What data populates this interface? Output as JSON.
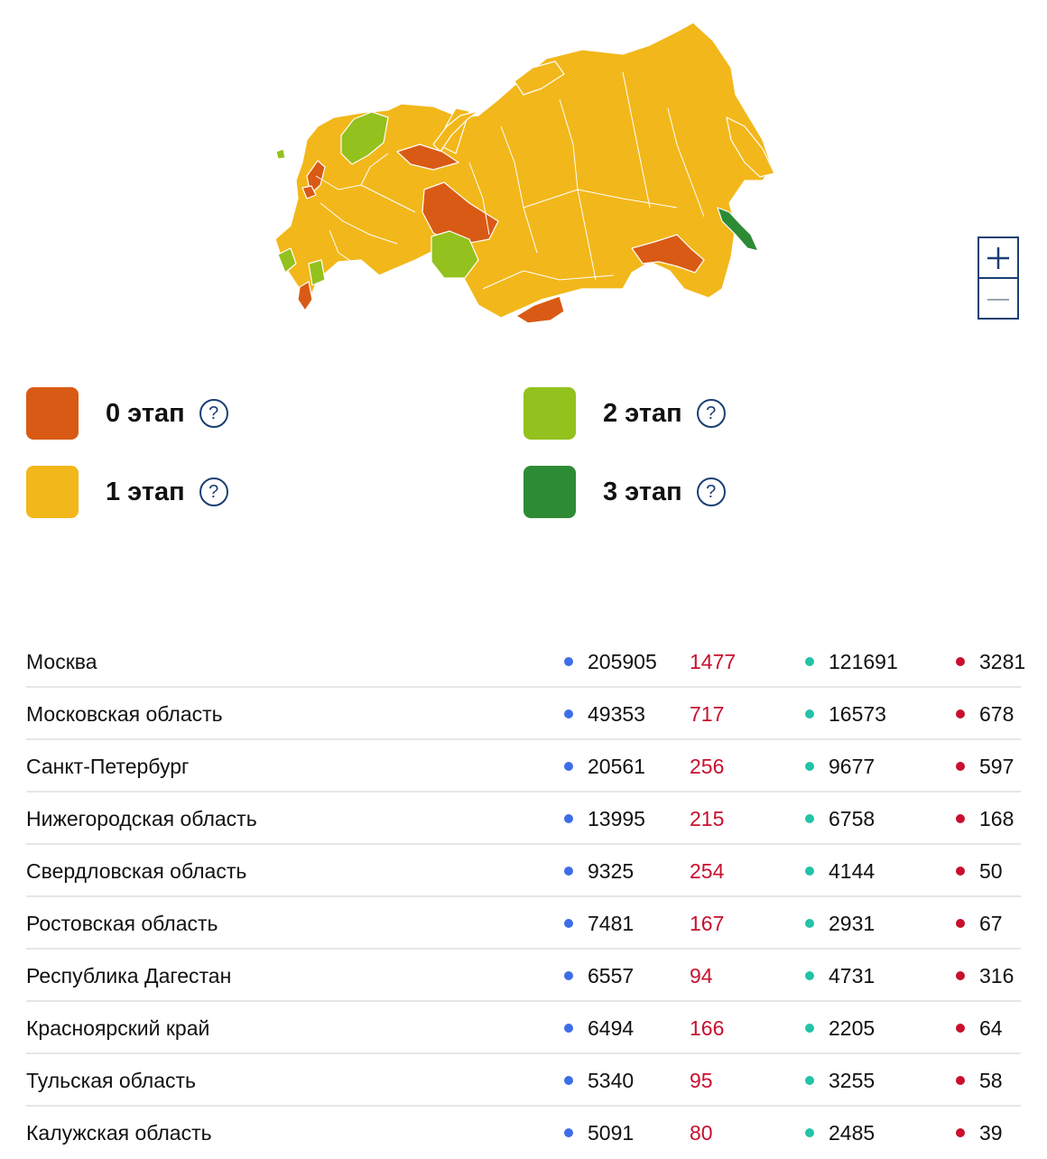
{
  "colors": {
    "stage0": "#d95a14",
    "stage1": "#f2b71a",
    "stage2": "#93c11d",
    "stage3": "#2e8b35",
    "accent": "#1b3f73",
    "new_cases": "#c8102e",
    "dot_cases": "#3d6ee8",
    "dot_recovered": "#22c3a6",
    "dot_deaths": "#c8102e"
  },
  "map": {
    "zoom_in_icon": "plus-icon",
    "zoom_out_icon": "minus-icon"
  },
  "legend": [
    {
      "label": "0 этап",
      "help": "?"
    },
    {
      "label": "1 этап",
      "help": "?"
    },
    {
      "label": "2 этап",
      "help": "?"
    },
    {
      "label": "3 этап",
      "help": "?"
    }
  ],
  "table": {
    "rows": [
      {
        "region": "Москва",
        "cases": "205905",
        "new": "1477",
        "recovered": "121691",
        "deaths": "3281"
      },
      {
        "region": "Московская область",
        "cases": "49353",
        "new": "717",
        "recovered": "16573",
        "deaths": "678"
      },
      {
        "region": "Санкт-Петербург",
        "cases": "20561",
        "new": "256",
        "recovered": "9677",
        "deaths": "597"
      },
      {
        "region": "Нижегородская область",
        "cases": "13995",
        "new": "215",
        "recovered": "6758",
        "deaths": "168"
      },
      {
        "region": "Свердловская область",
        "cases": "9325",
        "new": "254",
        "recovered": "4144",
        "deaths": "50"
      },
      {
        "region": "Ростовская область",
        "cases": "7481",
        "new": "167",
        "recovered": "2931",
        "deaths": "67"
      },
      {
        "region": "Республика Дагестан",
        "cases": "6557",
        "new": "94",
        "recovered": "4731",
        "deaths": "316"
      },
      {
        "region": "Красноярский край",
        "cases": "6494",
        "new": "166",
        "recovered": "2205",
        "deaths": "64"
      },
      {
        "region": "Тульская область",
        "cases": "5340",
        "new": "95",
        "recovered": "3255",
        "deaths": "58"
      },
      {
        "region": "Калужская область",
        "cases": "5091",
        "new": "80",
        "recovered": "2485",
        "deaths": "39"
      }
    ]
  }
}
